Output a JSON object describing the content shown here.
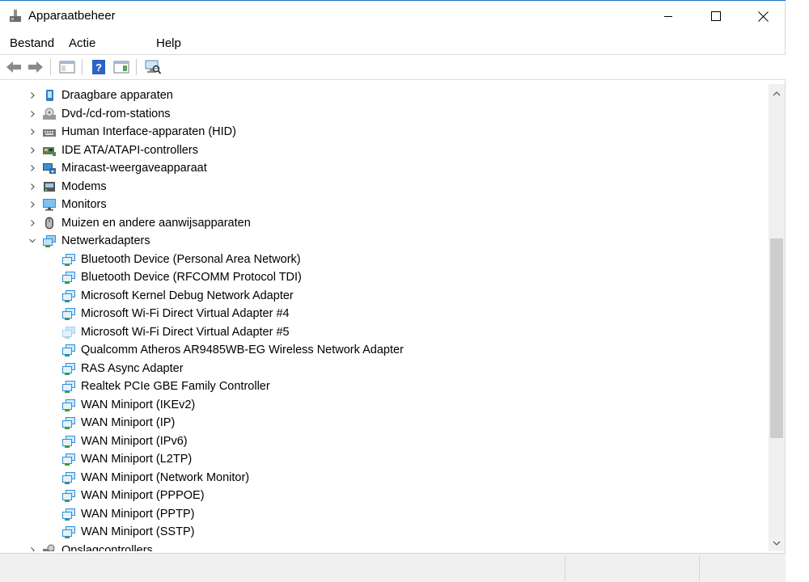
{
  "window": {
    "title": "Apparaatbeheer"
  },
  "menu": [
    {
      "label": "Bestand"
    },
    {
      "label": "Actie"
    },
    {
      "label": "Help"
    }
  ],
  "tree": {
    "categories_before": [
      {
        "label": "Draagbare apparaten",
        "icon": "portable-device-icon"
      },
      {
        "label": "Dvd-/cd-rom-stations",
        "icon": "dvd-drive-icon"
      },
      {
        "label": "Human Interface-apparaten (HID)",
        "icon": "hid-icon"
      },
      {
        "label": "IDE ATA/ATAPI-controllers",
        "icon": "ide-controller-icon"
      },
      {
        "label": "Miracast-weergaveapparaat",
        "icon": "miracast-icon"
      },
      {
        "label": "Modems",
        "icon": "modem-icon"
      },
      {
        "label": "Monitors",
        "icon": "monitor-icon"
      },
      {
        "label": "Muizen en andere aanwijsapparaten",
        "icon": "mouse-icon"
      }
    ],
    "expanded": {
      "label": "Netwerkadapters",
      "icon": "network-adapter-icon",
      "children": [
        {
          "label": "Bluetooth Device (Personal Area Network)"
        },
        {
          "label": "Bluetooth Device (RFCOMM Protocol TDI)"
        },
        {
          "label": "Microsoft Kernel Debug Network Adapter"
        },
        {
          "label": "Microsoft Wi-Fi Direct Virtual Adapter #4"
        },
        {
          "label": "Microsoft Wi-Fi Direct Virtual Adapter #5",
          "disabled": true
        },
        {
          "label": "Qualcomm Atheros AR9485WB-EG Wireless Network Adapter"
        },
        {
          "label": "RAS Async Adapter"
        },
        {
          "label": "Realtek PCIe GBE Family Controller"
        },
        {
          "label": "WAN Miniport (IKEv2)"
        },
        {
          "label": "WAN Miniport (IP)"
        },
        {
          "label": "WAN Miniport (IPv6)"
        },
        {
          "label": "WAN Miniport (L2TP)"
        },
        {
          "label": "WAN Miniport (Network Monitor)"
        },
        {
          "label": "WAN Miniport (PPPOE)"
        },
        {
          "label": "WAN Miniport (PPTP)"
        },
        {
          "label": "WAN Miniport (SSTP)"
        }
      ]
    },
    "categories_after": [
      {
        "label": "Opslagcontrollers",
        "icon": "storage-controller-icon"
      }
    ]
  },
  "colors": {
    "accent": "#1a73c4",
    "adapter": "#2f8fd8",
    "adapter_disabled": "#a9d2f0"
  }
}
